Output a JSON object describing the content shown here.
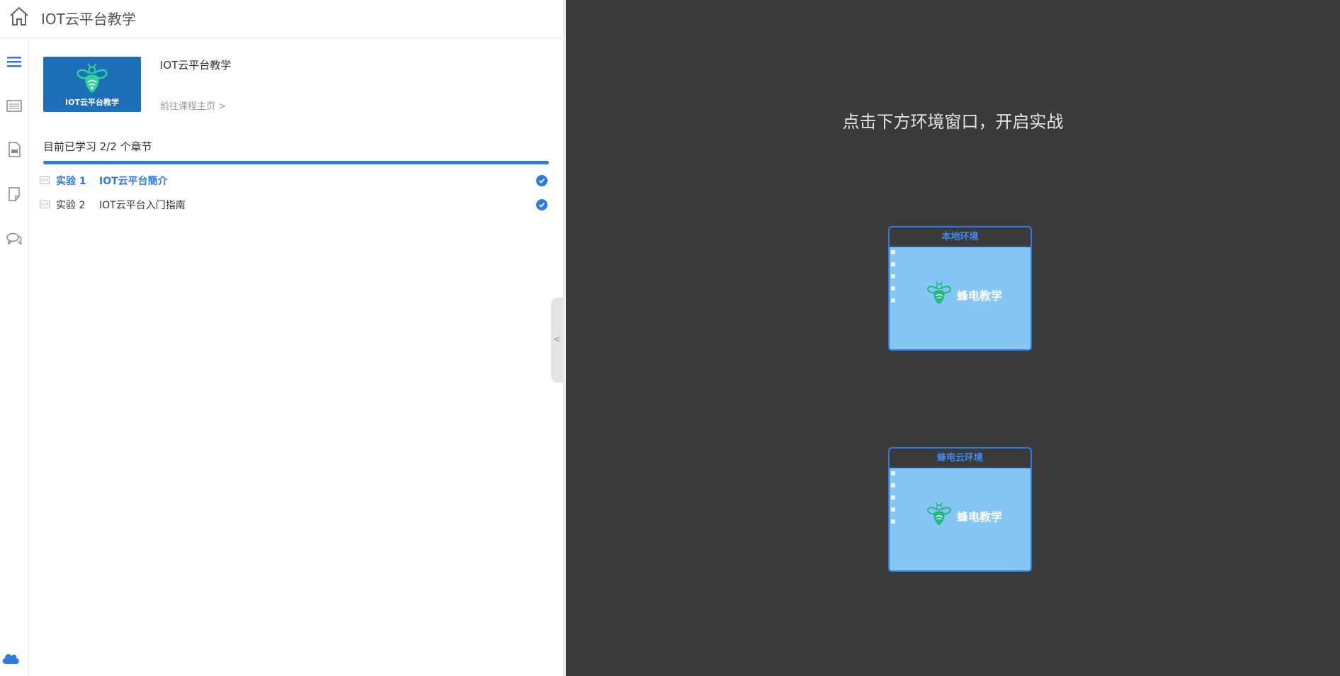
{
  "app": {
    "title": "IOT云平台教学"
  },
  "course": {
    "thumb_text": "IOT云平台教学",
    "name": "IOT云平台教学",
    "link_label": "前往课程主页 >"
  },
  "progress": {
    "label": "目前已学习 2/2 个章节",
    "fraction": 1.0
  },
  "lessons": [
    {
      "num": "实验 1",
      "title": "IOT云平台簡介",
      "done": true,
      "active": true
    },
    {
      "num": "实验 2",
      "title": "IOT云平台入门指南",
      "done": true,
      "active": false
    }
  ],
  "collapse_label": "<",
  "right": {
    "hint": "点击下方环境窗口，开启实战",
    "envs": [
      {
        "label": "本地环境",
        "logo_text": "蜂电教学"
      },
      {
        "label": "蜂电云环境",
        "logo_text": "蜂电教学"
      }
    ]
  },
  "colors": {
    "accent": "#2d7be2",
    "dark_bg": "#3a3a3a",
    "env_screen": "#85c6f4"
  },
  "rail_icons": [
    "menu-icon",
    "list-icon",
    "video-file-icon",
    "note-icon",
    "chat-icon"
  ]
}
